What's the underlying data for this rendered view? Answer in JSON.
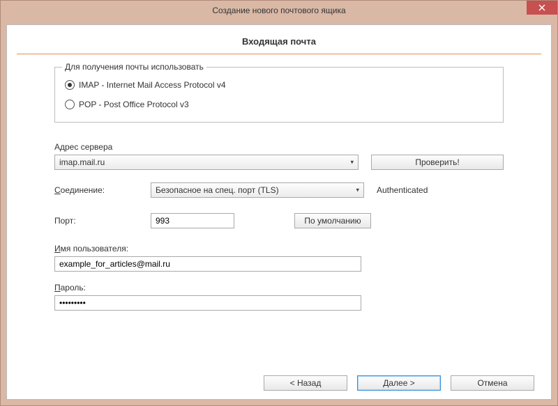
{
  "window": {
    "title": "Создание нового почтового ящика"
  },
  "page": {
    "heading": "Входящая почта"
  },
  "protocol": {
    "legend": "Для получения почты использовать",
    "imap_label": "IMAP - Internet Mail Access Protocol v4",
    "pop_label": "POP  -  Post Office Protocol v3",
    "selected": "imap"
  },
  "server": {
    "label": "Адрес сервера",
    "value": "imap.mail.ru",
    "verify_label": "Проверить!"
  },
  "connection": {
    "label": "Соединение:",
    "label_ul_char": "С",
    "label_rest": "оединение:",
    "value": "Безопасное на спец. порт (TLS)",
    "status": "Authenticated"
  },
  "port": {
    "label": "Порт:",
    "value": "993",
    "default_label": "По умолчанию"
  },
  "username": {
    "label_ul": "И",
    "label_rest": "мя пользователя:",
    "value": "example_for_articles@mail.ru"
  },
  "password": {
    "label_ul": "П",
    "label_rest": "ароль:",
    "value": "•••••••••"
  },
  "footer": {
    "back": "<  Назад",
    "next": "Далее   >",
    "cancel": "Отмена"
  }
}
